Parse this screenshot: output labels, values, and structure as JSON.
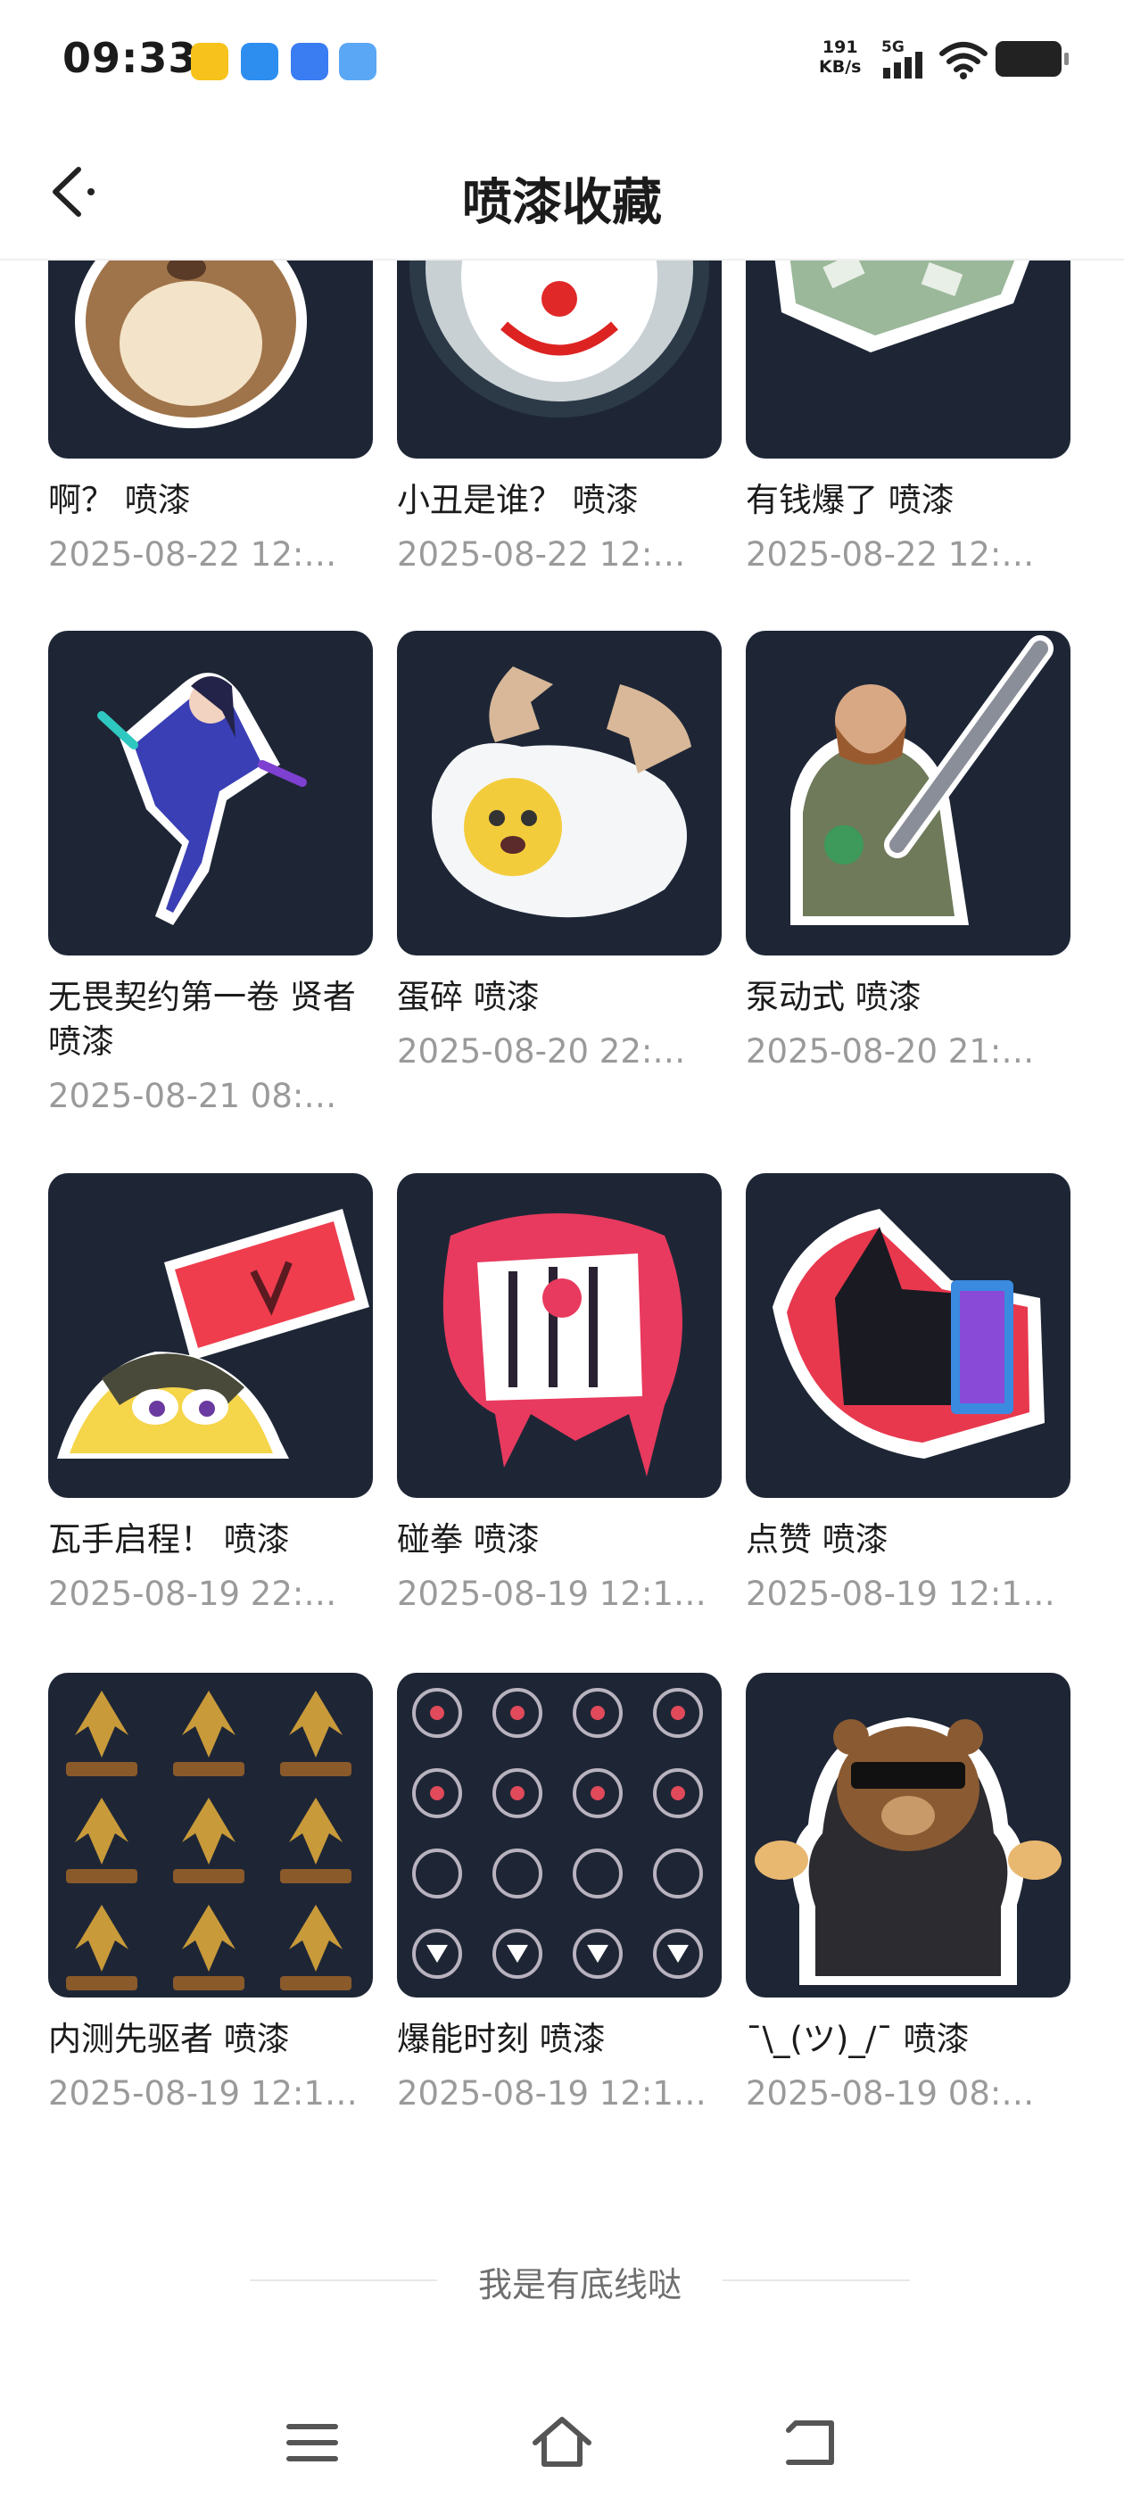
{
  "status_bar": {
    "time": "09:33",
    "network_speed_value": "191",
    "network_speed_unit": "KB/s",
    "network_type": "5G"
  },
  "header": {
    "title": "喷漆收藏"
  },
  "sprays": [
    {
      "label": "啊？  喷漆",
      "date": "2025-08-22 12:…",
      "art": "hamster-sticker"
    },
    {
      "label": "小丑是谁？  喷漆",
      "date": "2025-08-22 12:…",
      "art": "clown-sticker"
    },
    {
      "label": "有钱爆了 喷漆",
      "date": "2025-08-22 12:…",
      "art": "money-case-sticker"
    },
    {
      "label": "无畏契约第一卷 贤者 喷漆",
      "date": "2025-08-21 08:…",
      "art": "sage-sticker"
    },
    {
      "label": "蛋碎 喷漆",
      "date": "2025-08-20 22:…",
      "art": "cracked-egg-sticker"
    },
    {
      "label": "泵动式 喷漆",
      "date": "2025-08-20 21:…",
      "art": "shotgun-agent-sticker"
    },
    {
      "label": "瓦手启程！  喷漆",
      "date": "2025-08-19 22:…",
      "art": "yellow-creature-sign-sticker"
    },
    {
      "label": "碰拳 喷漆",
      "date": "2025-08-19 12:1…",
      "art": "fist-bump-sticker"
    },
    {
      "label": "点赞 喷漆",
      "date": "2025-08-19 12:1…",
      "art": "thumbs-up-sticker"
    },
    {
      "label": "内测先驱者 喷漆",
      "date": "2025-08-19 12:1…",
      "art": "beta-pioneer-pattern"
    },
    {
      "label": "爆能时刻 喷漆",
      "date": "2025-08-19 12:1…",
      "art": "power-moment-pattern"
    },
    {
      "label": "¯\\_(ツ)_/¯ 喷漆",
      "date": "2025-08-19 08:…",
      "art": "bear-sunglasses-sticker"
    }
  ],
  "footer": {
    "end_text": "我是有底线哒"
  },
  "nav_bar": {
    "menu_icon": "menu-icon",
    "home_icon": "home-icon",
    "back_icon": "back-icon"
  }
}
